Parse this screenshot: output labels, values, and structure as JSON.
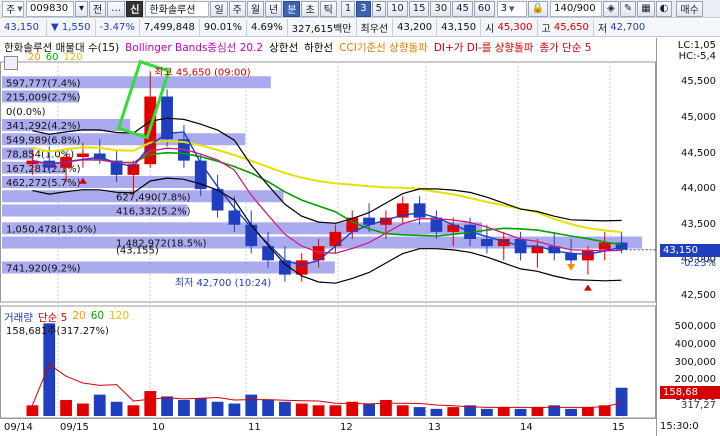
{
  "toolbar": {
    "market": "주",
    "code": "009830",
    "prev": "전",
    "badge": "신",
    "name": "한화솔루션",
    "periods": [
      "일",
      "주",
      "월",
      "년",
      "분",
      "초",
      "틱"
    ],
    "active_period": "분",
    "minutes": [
      "1",
      "3",
      "5",
      "10",
      "15",
      "30",
      "45",
      "60"
    ],
    "active_minute": "3",
    "interval_value": "3",
    "count": "140/900",
    "trade_btn": "매수"
  },
  "quote": {
    "price": "43,150",
    "change": "1,550",
    "change_pct": "-3.47%",
    "volume": "7,499,848",
    "ratio": "90.01%",
    "ratio2": "4.69%",
    "amount": "327,615백만",
    "best_label": "최우선",
    "best_ask": "43,200",
    "best_bid": "43,150",
    "open_label": "시",
    "open": "45,300",
    "high_label": "고",
    "high": "45,650",
    "low_label": "저",
    "low": "42,700"
  },
  "legend": {
    "title": "한화솔루션 매물대 수(15)",
    "items": [
      {
        "text": "Bollinger Bands중심선 20.2",
        "color": "#c000c0"
      },
      {
        "text": "상한선",
        "color": "#000000"
      },
      {
        "text": "하한선",
        "color": "#000000"
      },
      {
        "text": "CCI기준선 상향돌파",
        "color": "#e08000"
      },
      {
        "text": "DI+가 DI-를 상향돌파",
        "color": "#d00000"
      },
      {
        "text": "종가 단순 5",
        "color": "#d00000"
      }
    ],
    "ma_items": [
      {
        "text": "20",
        "color": "#ff9900"
      },
      {
        "text": "60",
        "color": "#00aa00"
      },
      {
        "text": "120",
        "color": "#e0c000"
      }
    ],
    "right_tag1": "LC:1,05",
    "right_tag2": "HC:-5,4"
  },
  "annotations": {
    "high": "최고 45,650 (09:00)",
    "low": "최저 42,700 (10:24)"
  },
  "volume_profile": [
    {
      "label": "597,777(7.4%)"
    },
    {
      "label": "215,009(2.7%)"
    },
    {
      "label": "0(0.0%)"
    },
    {
      "label": "341,292(4.2%)"
    },
    {
      "label": "549,989(6.8%)"
    },
    {
      "label": "78,854(1.0%)"
    },
    {
      "label": "167,281(2.1%)"
    },
    {
      "label": "462,272(5.7%)"
    },
    {
      "label": "627,490(7.8%)"
    },
    {
      "label": "416,332(5.2%)"
    },
    {
      "label": "1,050,478(13.0%)"
    },
    {
      "label": "1,482,972(18.5%)"
    },
    {
      "label": "(43,155)"
    },
    {
      "label": "741,920(9.2%)"
    }
  ],
  "price_axis": {
    "labels": [
      "45,500",
      "45,000",
      "44,500",
      "44,000",
      "43,500",
      "43,000",
      "42,500"
    ],
    "current": "43,150",
    "current_pct": "-0.23%"
  },
  "volume_panel": {
    "legend": [
      {
        "text": "거래량",
        "color": "#1f3fbf"
      },
      {
        "text": "단순 5",
        "color": "#d60000"
      },
      {
        "text": "20",
        "color": "#ff9900"
      },
      {
        "text": "60",
        "color": "#00aa00"
      },
      {
        "text": "120",
        "color": "#e0c000"
      }
    ],
    "value": "158,681주(317.27%)",
    "axis": [
      "500,000",
      "400,000",
      "300,000",
      "200,000",
      "100,000"
    ],
    "tag": "158,68",
    "tag2": "317,27"
  },
  "x_axis": [
    "09/14",
    "09/15",
    "10",
    "11",
    "12",
    "13",
    "14",
    "15"
  ],
  "x_axis_right": "15:30:0",
  "chart_data": {
    "type": "candlestick",
    "ylim": [
      42500,
      45700
    ],
    "ohlc": [
      [
        44350,
        44550,
        44200,
        44400
      ],
      [
        44400,
        44600,
        44250,
        44300
      ],
      [
        44300,
        44500,
        44100,
        44450
      ],
      [
        44450,
        44650,
        44300,
        44500
      ],
      [
        44500,
        44700,
        44350,
        44400
      ],
      [
        44400,
        44550,
        44100,
        44200
      ],
      [
        44200,
        44400,
        43900,
        44350
      ],
      [
        44350,
        45650,
        44300,
        45300
      ],
      [
        45300,
        45400,
        44600,
        44700
      ],
      [
        44700,
        44900,
        44300,
        44400
      ],
      [
        44400,
        44500,
        43900,
        44000
      ],
      [
        44000,
        44200,
        43600,
        43700
      ],
      [
        43700,
        43900,
        43400,
        43500
      ],
      [
        43500,
        43700,
        43100,
        43200
      ],
      [
        43200,
        43400,
        42900,
        43000
      ],
      [
        43000,
        43200,
        42700,
        42800
      ],
      [
        42800,
        43100,
        42700,
        43000
      ],
      [
        43000,
        43300,
        42900,
        43200
      ],
      [
        43200,
        43500,
        43100,
        43400
      ],
      [
        43400,
        43700,
        43300,
        43600
      ],
      [
        43600,
        43800,
        43400,
        43500
      ],
      [
        43500,
        43700,
        43300,
        43600
      ],
      [
        43600,
        43900,
        43500,
        43800
      ],
      [
        43800,
        43900,
        43500,
        43600
      ],
      [
        43600,
        43700,
        43300,
        43400
      ],
      [
        43400,
        43600,
        43200,
        43500
      ],
      [
        43500,
        43600,
        43200,
        43300
      ],
      [
        43300,
        43500,
        43100,
        43200
      ],
      [
        43200,
        43400,
        43000,
        43300
      ],
      [
        43300,
        43400,
        43000,
        43100
      ],
      [
        43100,
        43300,
        42900,
        43200
      ],
      [
        43200,
        43400,
        43000,
        43100
      ],
      [
        43100,
        43300,
        42900,
        43000
      ],
      [
        43000,
        43200,
        42800,
        43150
      ],
      [
        43150,
        43400,
        43000,
        43250
      ],
      [
        43250,
        43400,
        43100,
        43150
      ]
    ],
    "volumes": [
      60000,
      520000,
      90000,
      70000,
      120000,
      80000,
      60000,
      140000,
      110000,
      90000,
      100000,
      80000,
      70000,
      120000,
      90000,
      80000,
      70000,
      60000,
      60000,
      80000,
      70000,
      90000,
      60000,
      50000,
      40000,
      50000,
      60000,
      40000,
      50000,
      40000,
      50000,
      60000,
      40000,
      50000,
      60000,
      158681
    ]
  }
}
